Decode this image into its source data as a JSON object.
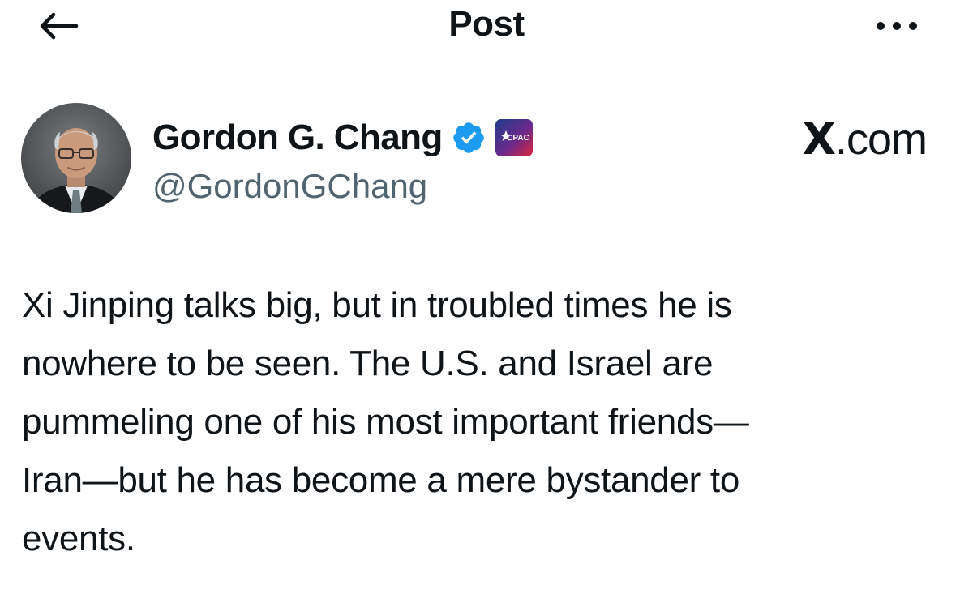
{
  "header": {
    "title": "Post",
    "back_icon": "arrow-left-icon",
    "more_icon": "more-horizontal-icon"
  },
  "author": {
    "display_name": "Gordon G. Chang",
    "handle": "@GordonGChang",
    "verified": true,
    "verified_color": "#1d9bf0",
    "affiliate_badge": "CPAC",
    "avatar_icon": "profile-avatar"
  },
  "watermark": {
    "x": "X",
    "domain": ".com"
  },
  "post": {
    "lines": [
      "Xi Jinping talks big, but in troubled times he is",
      "nowhere to be seen. The U.S. and Israel are",
      "pummeling one of his most important friends—",
      "Iran—but he has become a mere bystander to",
      "events."
    ]
  },
  "colors": {
    "text_primary": "#0f1419",
    "text_secondary": "#536471",
    "background": "#ffffff"
  }
}
